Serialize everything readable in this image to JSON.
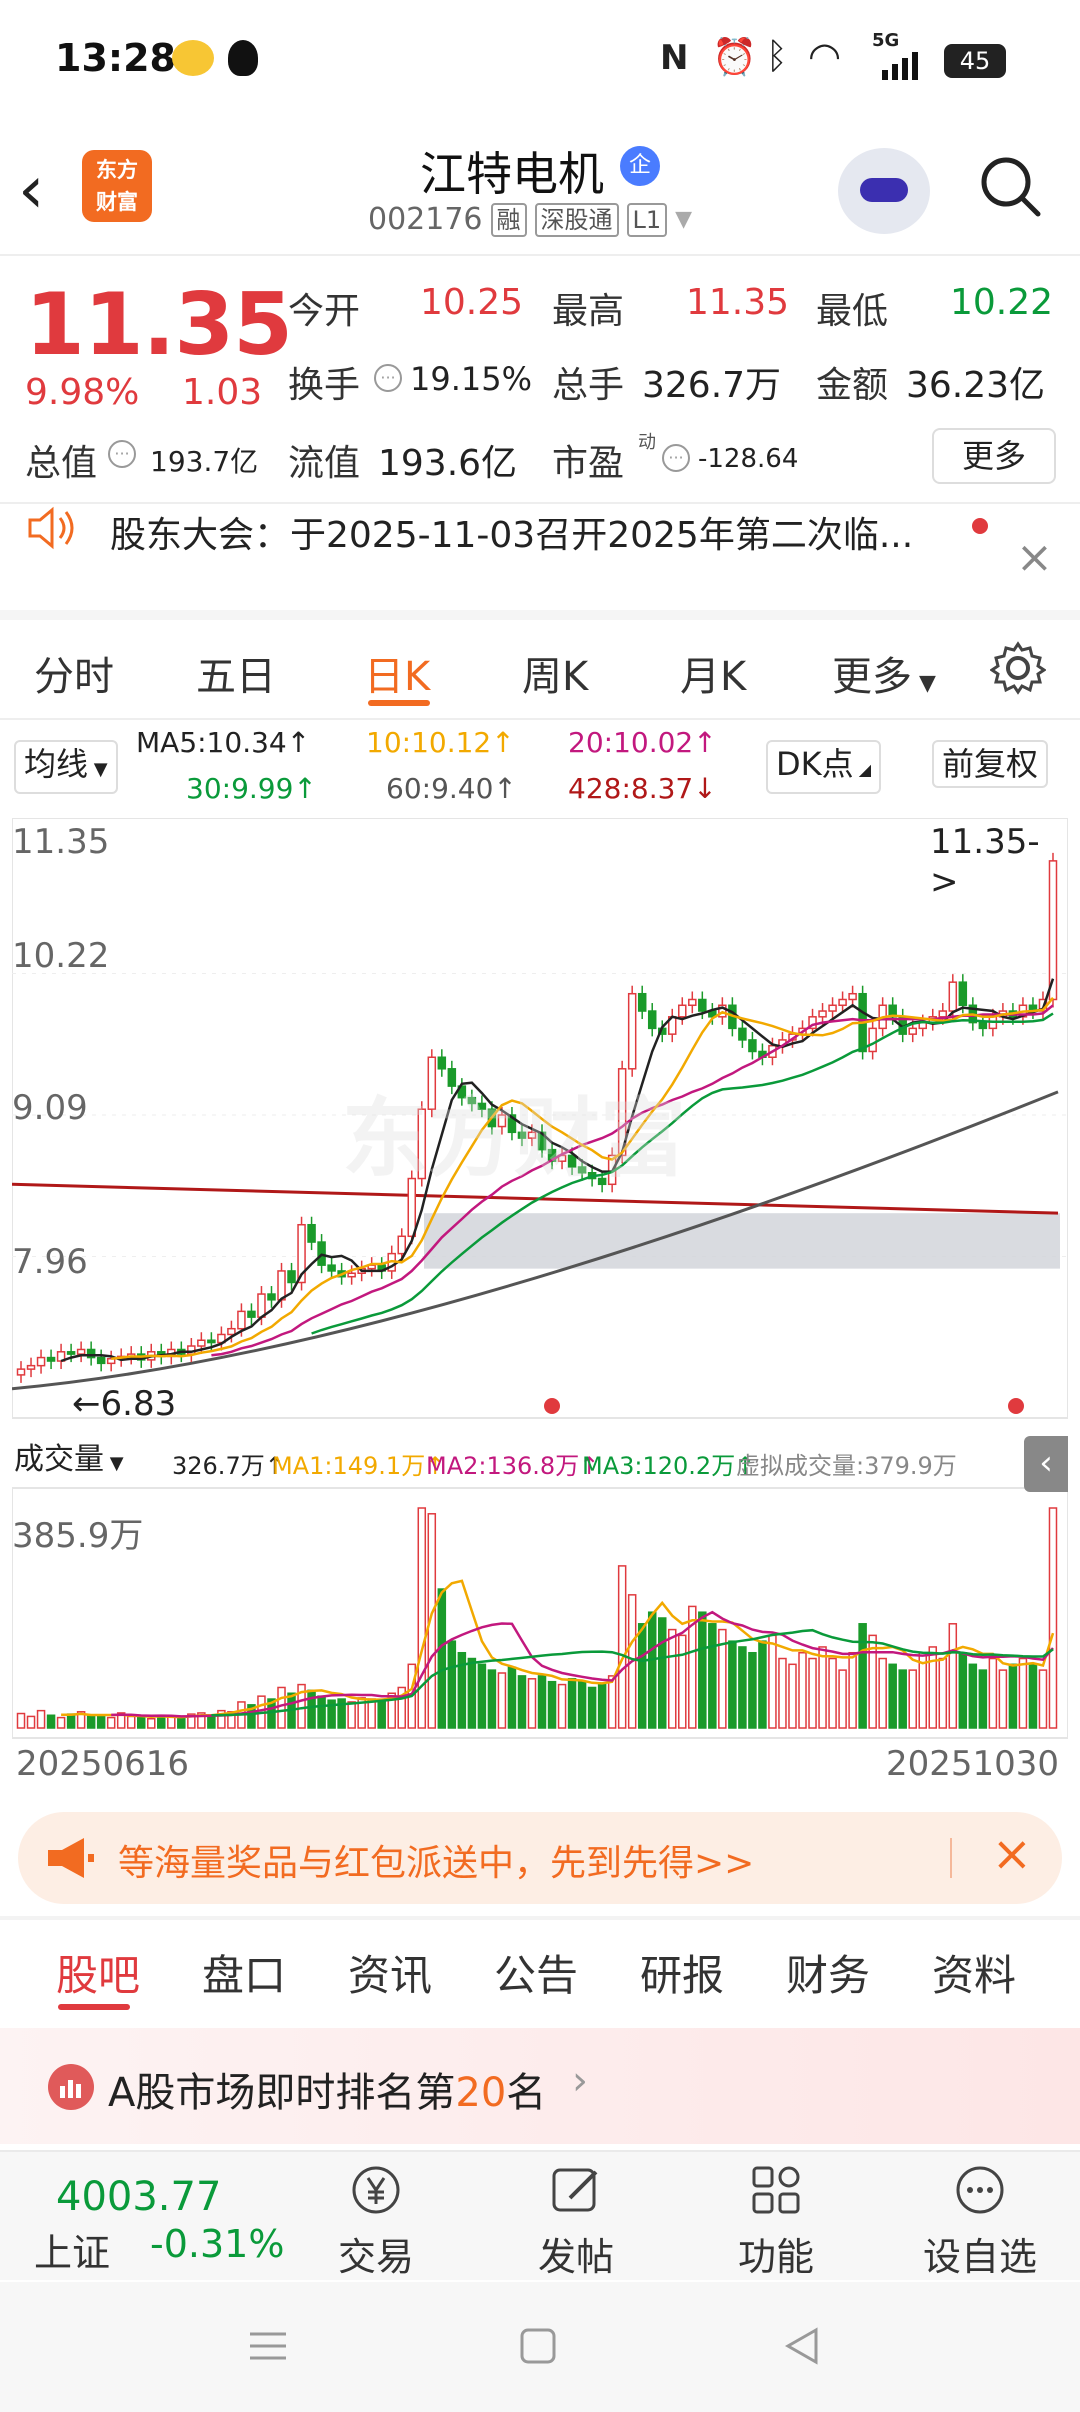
{
  "status_bar": {
    "time": "13:28",
    "network": "5G",
    "battery": "45"
  },
  "header": {
    "logo_line1": "东方",
    "logo_line2": "财富",
    "stock_name": "江特电机",
    "badge": "企",
    "stock_code": "002176",
    "tags": [
      "融",
      "深股通",
      "L1"
    ]
  },
  "quote": {
    "price": "11.35",
    "change_pct": "9.98%",
    "change_amt": "1.03",
    "open_label": "今开",
    "open": "10.25",
    "high_label": "最高",
    "high": "11.35",
    "low_label": "最低",
    "low": "10.22",
    "turnover_label": "换手",
    "turnover": "19.15%",
    "volume_label": "总手",
    "volume": "326.7万",
    "amount_label": "金额",
    "amount": "36.23亿",
    "mktcap_label": "总值",
    "mktcap": "193.7亿",
    "float_label": "流值",
    "float": "193.6亿",
    "pe_label": "市盈",
    "pe_sup": "动",
    "pe": "-128.64",
    "more_button": "更多"
  },
  "notice": {
    "text": "股东大会：于2025-11-03召开2025年第二次临..."
  },
  "kline_tabs": {
    "items": [
      "分时",
      "五日",
      "日K",
      "周K",
      "月K",
      "更多"
    ],
    "active": "日K"
  },
  "ma_legend": {
    "selector": "均线",
    "ma5": "MA5:10.34↑",
    "ma10": "10:10.12↑",
    "ma20": "20:10.02↑",
    "ma30": "30:9.99↑",
    "ma60": "60:9.40↑",
    "ma428": "428:8.37↓",
    "dk_button": "DK点",
    "adjust_button": "前复权"
  },
  "chart_data": {
    "type": "candlestick",
    "y_ticks": [
      "11.35",
      "10.22",
      "9.09",
      "7.96"
    ],
    "last_price_tag": "11.35->",
    "low_marker": "6.83",
    "watermark": "东方财富",
    "volume_selector": "成交量",
    "volume_legend": {
      "vol": "326.7万↑",
      "ma1": "MA1:149.1万↑",
      "ma2": "MA2:136.8万↑",
      "ma3": "MA3:120.2万↑",
      "virtual": "虚拟成交量:379.9万"
    },
    "volume_max_label": "385.9万",
    "date_start": "20250616",
    "date_end": "20251030",
    "ylim": [
      6.7,
      11.6
    ],
    "closes": [
      6.95,
      6.98,
      7.05,
      7.02,
      7.1,
      7.08,
      7.12,
      7.05,
      7.0,
      7.04,
      7.06,
      7.08,
      7.03,
      7.1,
      7.06,
      7.12,
      7.08,
      7.15,
      7.2,
      7.18,
      7.25,
      7.3,
      7.45,
      7.4,
      7.6,
      7.55,
      7.8,
      7.7,
      8.2,
      8.05,
      7.85,
      7.8,
      7.75,
      7.78,
      7.82,
      7.85,
      7.8,
      7.95,
      8.1,
      8.6,
      9.2,
      9.65,
      9.55,
      9.4,
      9.3,
      9.25,
      9.2,
      9.05,
      9.15,
      9.0,
      8.95,
      9.0,
      8.85,
      8.75,
      8.8,
      8.7,
      8.65,
      8.6,
      8.55,
      8.8,
      9.55,
      10.2,
      10.05,
      9.9,
      9.85,
      10.0,
      10.1,
      10.15,
      10.05,
      10.0,
      10.1,
      9.9,
      9.8,
      9.7,
      9.65,
      9.75,
      9.8,
      9.85,
      9.9,
      10.0,
      10.05,
      10.1,
      10.15,
      10.2,
      9.7,
      9.9,
      10.1,
      10.0,
      9.85,
      9.9,
      9.95,
      10.0,
      10.05,
      10.3,
      10.1,
      9.95,
      9.9,
      10.0,
      10.05,
      10.0,
      10.1,
      10.05,
      10.15,
      11.35
    ],
    "volumes": [
      25,
      20,
      30,
      22,
      18,
      24,
      28,
      20,
      22,
      18,
      26,
      20,
      18,
      16,
      22,
      20,
      18,
      24,
      26,
      22,
      30,
      28,
      45,
      40,
      55,
      50,
      70,
      60,
      75,
      65,
      55,
      48,
      50,
      45,
      52,
      50,
      48,
      60,
      70,
      110,
      380,
      370,
      240,
      150,
      130,
      120,
      110,
      100,
      95,
      105,
      90,
      85,
      90,
      80,
      75,
      85,
      80,
      70,
      75,
      90,
      280,
      230,
      180,
      200,
      190,
      170,
      160,
      210,
      200,
      180,
      170,
      150,
      140,
      130,
      150,
      160,
      120,
      110,
      130,
      120,
      140,
      120,
      100,
      130,
      180,
      160,
      120,
      110,
      100,
      100,
      130,
      140,
      120,
      180,
      130,
      110,
      100,
      120,
      100,
      110,
      120,
      110,
      100,
      380
    ],
    "ma5": [
      null,
      null,
      null,
      null,
      7.02,
      7.05,
      7.07,
      7.07,
      7.07,
      7.06,
      7.03,
      7.04,
      7.04,
      7.06,
      7.07,
      7.08,
      7.1,
      7.1,
      7.12,
      7.14,
      7.17,
      7.23,
      7.28,
      7.32,
      7.4,
      7.46,
      7.56,
      7.61,
      7.77,
      7.86,
      7.94,
      7.92,
      7.93,
      7.89,
      7.8,
      7.8,
      7.8,
      7.84,
      7.9,
      8.06,
      8.33,
      8.68,
      8.98,
      9.28,
      9.42,
      9.43,
      9.34,
      9.24,
      9.19,
      9.13,
      9.07,
      9.03,
      8.99,
      8.91,
      8.87,
      8.82,
      8.75,
      8.7,
      8.66,
      8.66,
      8.83,
      9.14,
      9.42,
      9.7,
      9.91,
      10.0,
      9.98,
      10.01,
      10.03,
      10.06,
      10.08,
      10.04,
      9.97,
      9.9,
      9.83,
      9.76,
      9.74,
      9.77,
      9.79,
      9.86,
      9.92,
      9.98,
      10.04,
      10.1,
      10.04,
      9.99,
      9.98,
      9.98,
      9.91,
      9.95,
      9.96,
      9.94,
      9.95,
      10.04,
      10.08,
      10.07,
      10.06,
      10.05,
      10.0,
      9.98,
      10.01,
      10.04,
      10.07,
      10.33
    ],
    "ma20": [
      null,
      null,
      null,
      null,
      null,
      null,
      null,
      null,
      null,
      null,
      null,
      null,
      null,
      null,
      null,
      null,
      null,
      null,
      null,
      7.07,
      7.08,
      7.1,
      7.13,
      7.15,
      7.18,
      7.21,
      7.25,
      7.28,
      7.34,
      7.39,
      7.43,
      7.47,
      7.51,
      7.54,
      7.58,
      7.62,
      7.65,
      7.69,
      7.73,
      7.8,
      7.89,
      7.99,
      8.09,
      8.17,
      8.25,
      8.33,
      8.4,
      8.46,
      8.53,
      8.58,
      8.62,
      8.67,
      8.71,
      8.76,
      8.81,
      8.85,
      8.89,
      8.92,
      8.95,
      8.99,
      9.05,
      9.12,
      9.17,
      9.21,
      9.24,
      9.28,
      9.31,
      9.35,
      9.38,
      9.42,
      9.47,
      9.51,
      9.56,
      9.6,
      9.65,
      9.7,
      9.75,
      9.81,
      9.87,
      9.93,
      9.95,
      9.96,
      9.97,
      9.98,
      9.97,
      9.97,
      9.98,
      9.98,
      9.98,
      9.98,
      9.98,
      9.98,
      9.99,
      10.0,
      10.01,
      10.01,
      10.02,
      10.02,
      10.02,
      10.02,
      10.02,
      10.02,
      10.03,
      10.1
    ]
  },
  "promo": {
    "text": "等海量奖品与红包派送中，先到先得>>"
  },
  "bottom_tabs": {
    "items": [
      "股吧",
      "盘口",
      "资讯",
      "公告",
      "研报",
      "财务",
      "资料"
    ],
    "active": "股吧"
  },
  "rank_banner": {
    "prefix": "A股市场即时排名第",
    "rank": "20",
    "suffix": "名"
  },
  "toolbar": {
    "index_value": "4003.77",
    "index_name": "上证",
    "index_change": "-0.31%",
    "trade": "交易",
    "post": "发帖",
    "features": "功能",
    "watchlist": "设自选"
  }
}
